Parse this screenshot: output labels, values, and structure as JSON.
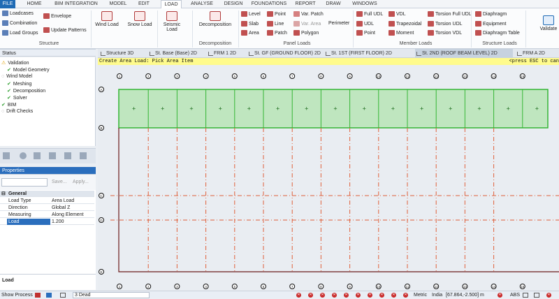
{
  "menubar": {
    "items": [
      "FILE",
      "HOME",
      "BIM INTEGRATION",
      "MODEL",
      "EDIT",
      "LOAD",
      "ANALYSE",
      "DESIGN",
      "FOUNDATIONS",
      "REPORT",
      "DRAW",
      "WINDOWS"
    ],
    "active": "LOAD"
  },
  "ribbon": {
    "structure": {
      "loadcases": "Loadcases",
      "envelope": "Envelope",
      "combination": "Combination",
      "load_groups": "Load Groups",
      "update_patterns": "Update Patterns",
      "group": "Structure"
    },
    "wind_load": "Wind Load",
    "snow_load": "Snow Load",
    "seismic_load_line1": "Seismic",
    "seismic_load_line2": "Load",
    "decomposition": "Decomposition",
    "decomposition_group": "Decomposition",
    "panel": {
      "level": "Level",
      "slab": "Slab",
      "area": "Area",
      "point": "Point",
      "line": "Line",
      "patch": "Patch",
      "var_patch": "Var. Patch",
      "var_area": "Var. Area",
      "polygon": "Polygon",
      "perimeter": "Perimeter",
      "group": "Panel Loads"
    },
    "member": {
      "full_udl": "Full UDL",
      "udl": "UDL",
      "point": "Point",
      "vdl": "VDL",
      "trapezoidal": "Trapezoidal",
      "moment": "Moment",
      "torsion_full_udl": "Torsion Full UDL",
      "torsion_udl": "Torsion UDL",
      "torsion_vdl": "Torsion VDL",
      "group": "Member Loads"
    },
    "structure_loads": {
      "diaphragm": "Diaphragm",
      "equipment": "Equipment",
      "diaphragm_table": "Diaphragm Table",
      "group": "Structure Loads"
    },
    "validate": "Validate"
  },
  "status_panel": {
    "title": "Status",
    "items": [
      "Validation",
      "Model Geometry",
      "Wind Model",
      "Meshing",
      "Decomposition",
      "Solver",
      "BIM",
      "Drift Checks"
    ]
  },
  "properties": {
    "title": "Properties",
    "save": "Save...",
    "apply": "Apply...",
    "section": "General",
    "rows": [
      {
        "key": "Load Type",
        "value": "Area Load"
      },
      {
        "key": "Direction",
        "value": "Global Z"
      },
      {
        "key": "Measuring",
        "value": "Along Element"
      },
      {
        "key": "Load",
        "value": "1.200"
      }
    ]
  },
  "bottom_panel": {
    "title": "Load"
  },
  "tabs": [
    "Structure 3D",
    "St. Base (Base) 2D",
    "FRM 1 2D",
    "St. GF (GROUND FLOOR) 2D",
    "St. 1ST (FIRST FLOOR) 2D",
    "St. 2ND (ROOF BEAM LEVEL) 2D",
    "FRM A 2D"
  ],
  "active_tab": "St. 2ND (ROOF BEAM LEVEL) 2D",
  "canvas": {
    "hint_left": "Create Area Load: Pick Area Item",
    "hint_right": "<press ESC to can",
    "grid_numbers": [
      "1",
      "2",
      "3",
      "4",
      "5",
      "6",
      "7",
      "8",
      "9",
      "10",
      "11",
      "12",
      "13",
      "14",
      "15"
    ],
    "grid_letters": [
      "A",
      "B",
      "C",
      "D",
      "E"
    ],
    "area_marker": "+",
    "colors": {
      "area_fill": "#bfe6bf",
      "area_edge": "#34b534",
      "grid": "#e0603a",
      "outline": "#6b1c1c"
    }
  },
  "statusbar": {
    "show_process": "Show Process",
    "loadcase": "3 Dead",
    "metric": "Metric",
    "country": "India",
    "coords": "[67.864,-2.500] m",
    "abs": "ABS"
  }
}
